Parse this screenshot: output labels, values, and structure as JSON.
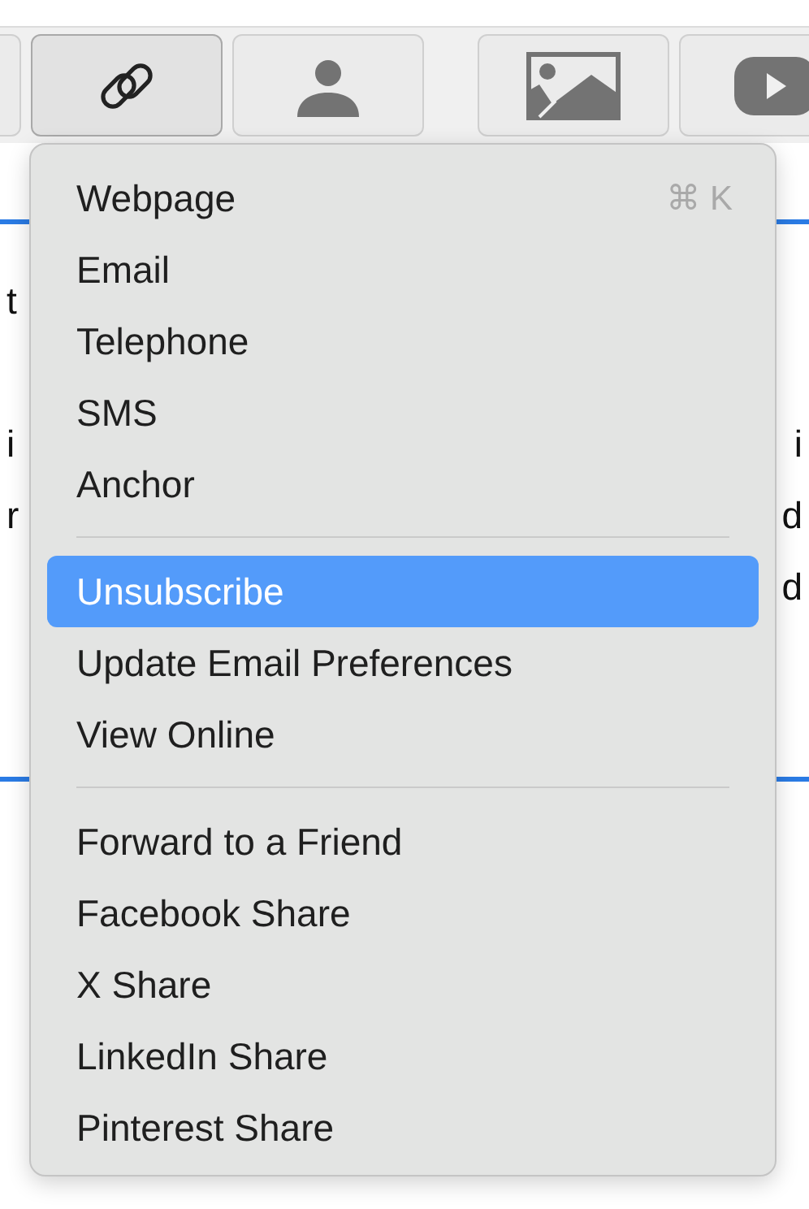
{
  "toolbar": {
    "groups": [
      [
        {
          "kind": "blank",
          "selected": false
        },
        {
          "kind": "link",
          "selected": true
        },
        {
          "kind": "person",
          "selected": false
        }
      ],
      [
        {
          "kind": "image",
          "selected": false
        },
        {
          "kind": "video",
          "selected": false
        }
      ]
    ]
  },
  "content": {
    "rows": [
      {
        "left": "t"
      },
      {},
      {
        "left": "i",
        "right": "i"
      },
      {
        "left": "r",
        "right": "d"
      },
      {
        "right": "d"
      }
    ]
  },
  "menu": {
    "groups": [
      [
        {
          "label": "Webpage",
          "shortcut": "⌘ K",
          "selected": false
        },
        {
          "label": "Email",
          "selected": false
        },
        {
          "label": "Telephone",
          "selected": false
        },
        {
          "label": "SMS",
          "selected": false
        },
        {
          "label": "Anchor",
          "selected": false
        }
      ],
      [
        {
          "label": "Unsubscribe",
          "selected": true
        },
        {
          "label": "Update Email Preferences",
          "selected": false
        },
        {
          "label": "View Online",
          "selected": false
        }
      ],
      [
        {
          "label": "Forward to a Friend",
          "selected": false
        },
        {
          "label": "Facebook Share",
          "selected": false
        },
        {
          "label": "X Share",
          "selected": false
        },
        {
          "label": "LinkedIn Share",
          "selected": false
        },
        {
          "label": "Pinterest Share",
          "selected": false
        }
      ]
    ]
  }
}
